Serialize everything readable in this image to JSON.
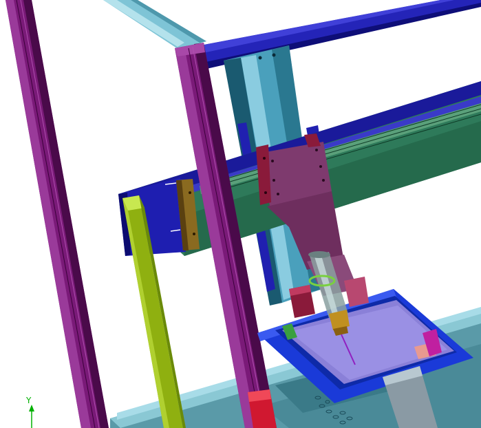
{
  "scene": {
    "description_colors": {
      "upright_purple": "#7a1a78",
      "upright_purple_dark": "#4a0a4a",
      "upright_purple_light": "#9a3a9a",
      "beam_blue": "#2020b0",
      "beam_blue_dark": "#0a0a70",
      "rail_cyan": "#6fb8cc",
      "rail_cyan_light": "#a8dce8",
      "carriage_teal": "#2e8aa8",
      "gantry_green": "#2e7a5a",
      "gantry_green_dark": "#1a4e38",
      "yellow_green": "#8fb010",
      "yellow_green_light": "#c0e040",
      "plate_mauve": "#7e3a6e",
      "bracket_maroon": "#8a1a3a",
      "bracket_brown": "#8a6a20",
      "tray_blue": "#1a3ad8",
      "tray_lavender": "#8a80d8",
      "floor_teal": "#4a90a0",
      "red_block": "#d01830",
      "pink_pad": "#e89a90",
      "green_tab": "#3aa040",
      "magenta_tab": "#c020a0",
      "syringe_grey": "#8aa0a0",
      "nozzle_gold": "#c09020",
      "needle_purple": "#9020c0",
      "axis_green": "#00b000"
    }
  },
  "axis_triad": {
    "y_label": "Y"
  }
}
